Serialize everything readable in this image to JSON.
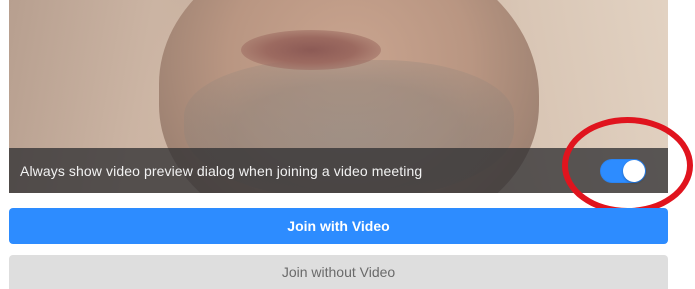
{
  "preview": {
    "always_show_label": "Always show video preview dialog when joining a video meeting",
    "toggle_state": "on"
  },
  "buttons": {
    "join_with_video": "Join with Video",
    "join_without_video": "Join without Video"
  },
  "colors": {
    "accent": "#2d8cff",
    "annotation": "#e0141e",
    "secondary_button": "#dedede"
  },
  "icons": {
    "toggle": "toggle-switch"
  }
}
